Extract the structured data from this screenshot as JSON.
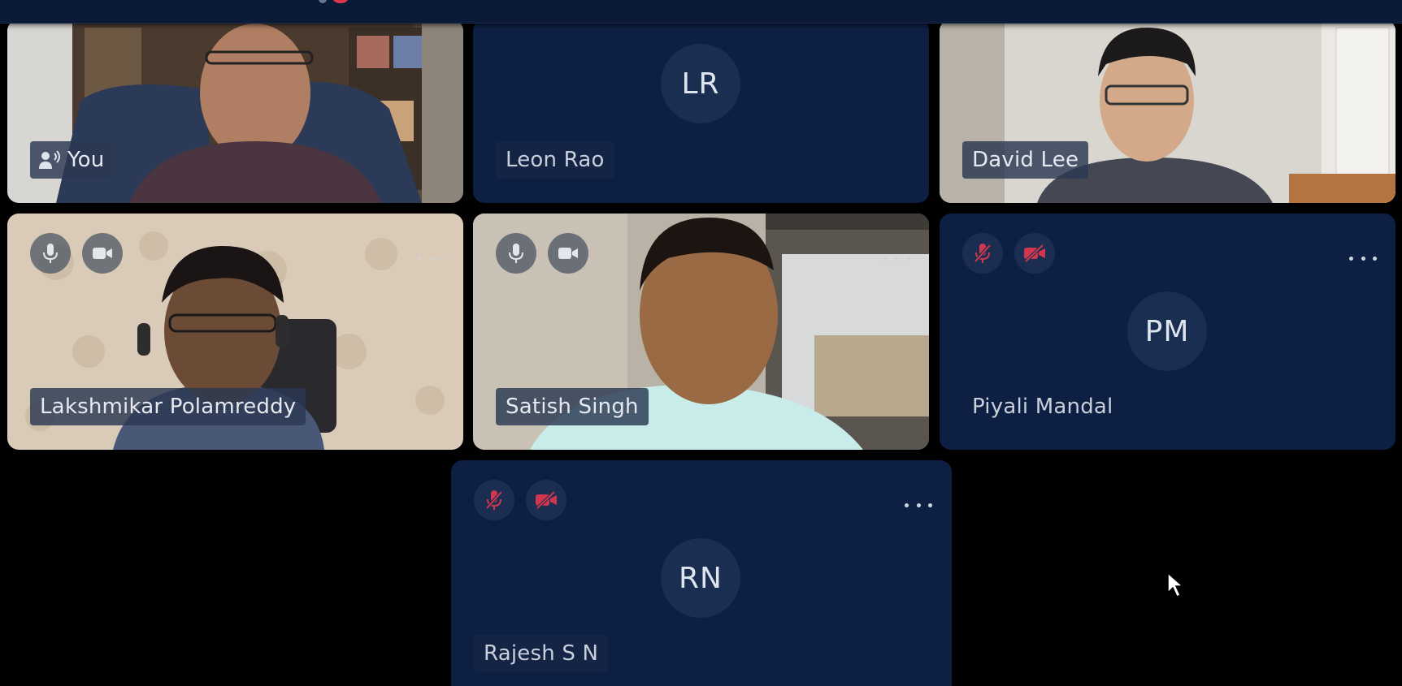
{
  "participants": [
    {
      "id": "you",
      "name": "You",
      "video": true,
      "audio_icon": "speaker-icon"
    },
    {
      "id": "leon",
      "name": "Leon Rao",
      "initials": "LR",
      "video": false
    },
    {
      "id": "david",
      "name": "David Lee",
      "video": true
    },
    {
      "id": "lakshmikar",
      "name": "Lakshmikar Polamreddy",
      "video": true,
      "mic": "on",
      "camera": "on"
    },
    {
      "id": "satish",
      "name": "Satish Singh",
      "video": true,
      "mic": "on",
      "camera": "on"
    },
    {
      "id": "piyali",
      "name": "Piyali Mandal",
      "initials": "PM",
      "video": false,
      "mic": "muted",
      "camera": "off"
    },
    {
      "id": "rajesh",
      "name": "Rajesh S N",
      "initials": "RN",
      "video": false,
      "mic": "muted",
      "camera": "off"
    }
  ],
  "colors": {
    "background": "#000000",
    "tile_background": "#0d1f43",
    "topbar": "#0b1a36",
    "muted_red": "#d0374f",
    "avatar_circle": "#1a2e52"
  }
}
